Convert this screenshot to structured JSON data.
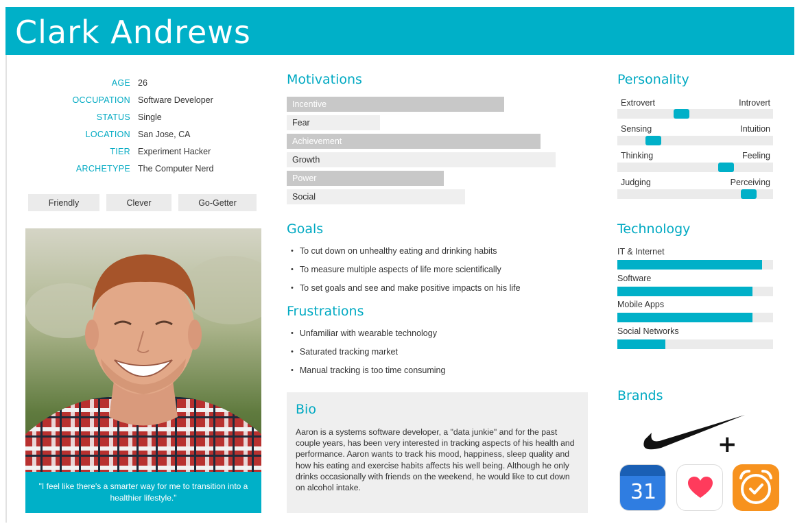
{
  "persona": {
    "name": "Clark Andrews"
  },
  "colors": {
    "accent": "#00b0c8",
    "bar_dark": "#c8c8c8",
    "bar_light": "#efefef",
    "track": "#ebebeb"
  },
  "profile": [
    {
      "label": "AGE",
      "value": "26"
    },
    {
      "label": "OCCUPATION",
      "value": "Software Developer"
    },
    {
      "label": "STATUS",
      "value": "Single"
    },
    {
      "label": "LOCATION",
      "value": "San Jose, CA"
    },
    {
      "label": "TIER",
      "value": "Experiment Hacker"
    },
    {
      "label": "ARCHETYPE",
      "value": "The Computer Nerd"
    }
  ],
  "traits": [
    "Friendly",
    "Clever",
    "Go-Getter"
  ],
  "photo": {
    "alt": "portrait-photo",
    "quote": "\"I feel like there's a smarter way for me to transition into a healthier lifestyle.\""
  },
  "motivations": {
    "title": "Motivations",
    "items": [
      {
        "label": "Incentive",
        "level": 0.72
      },
      {
        "label": "Fear",
        "level": 0.31
      },
      {
        "label": "Achievement",
        "level": 0.84
      },
      {
        "label": "Growth",
        "level": 0.89
      },
      {
        "label": "Power",
        "level": 0.52
      },
      {
        "label": "Social",
        "level": 0.59
      }
    ]
  },
  "goals": {
    "title": "Goals",
    "items": [
      "To cut down on unhealthy eating and drinking habits",
      "To measure multiple aspects of life more scientifically",
      "To set goals and see and make positive impacts on his life"
    ]
  },
  "frustrations": {
    "title": "Frustrations",
    "items": [
      "Unfamiliar with wearable technology",
      "Saturated tracking market",
      "Manual tracking is too time consuming"
    ]
  },
  "bio": {
    "title": "Bio",
    "text": "Aaron is a systems software developer, a \"data junkie\" and for the past couple years, has been very interested in tracking aspects of his health and performance. Aaron wants to track his mood, happiness, sleep quality and how his eating and exercise habits affects his well being. Although he only drinks occasionally with friends on the weekend, he would like to cut down on alcohol intake."
  },
  "personality": {
    "title": "Personality",
    "scales": [
      {
        "left": "Extrovert",
        "right": "Introvert",
        "level": 0.4
      },
      {
        "left": "Sensing",
        "right": "Intuition",
        "level": 0.2
      },
      {
        "left": "Thinking",
        "right": "Feeling",
        "level": 0.72
      },
      {
        "left": "Judging",
        "right": "Perceiving",
        "level": 0.88
      }
    ]
  },
  "technology": {
    "title": "Technology",
    "items": [
      {
        "label": "IT & Internet",
        "level": 0.93
      },
      {
        "label": "Software",
        "level": 0.87
      },
      {
        "label": "Mobile Apps",
        "level": 0.87
      },
      {
        "label": "Social Networks",
        "level": 0.31
      }
    ]
  },
  "brands": {
    "title": "Brands",
    "logos": [
      "nike-plus-logo",
      "google-calendar-icon",
      "apple-health-icon",
      "sleep-alarm-app-icon"
    ],
    "calendar_day": "31",
    "plus_sign": "+"
  }
}
